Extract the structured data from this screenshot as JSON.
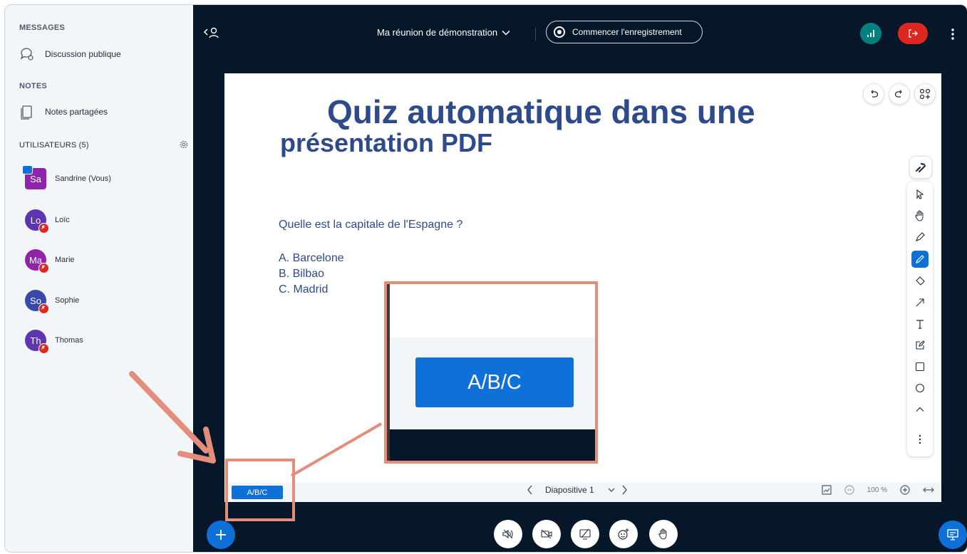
{
  "sidebar": {
    "messages_title": "MESSAGES",
    "public_chat": "Discussion publique",
    "notes_title": "NOTES",
    "shared_notes": "Notes partagées",
    "users_title": "UTILISATEURS (5)",
    "users": [
      {
        "initials": "Sa",
        "name": "Sandrine (Vous)",
        "color": "#8e24aa"
      },
      {
        "initials": "Lo",
        "name": "Loïc",
        "color": "#5e35b1"
      },
      {
        "initials": "Ma",
        "name": "Marie",
        "color": "#8e24aa"
      },
      {
        "initials": "So",
        "name": "Sophie",
        "color": "#3949ab"
      },
      {
        "initials": "Th",
        "name": "Thomas",
        "color": "#5e35b1"
      }
    ]
  },
  "header": {
    "meeting_title": "Ma réunion de démonstration",
    "record_label": "Commencer l'enregistrement"
  },
  "slide": {
    "title_line1": "Quiz automatique dans une",
    "title_line2": "présentation PDF",
    "question": "Quelle est la capitale de l'Espagne ?",
    "answers": [
      "A. Barcelone",
      "B. Bilbao",
      "C. Madrid"
    ]
  },
  "slidebar": {
    "quiz_button": "A/B/C",
    "slide_label": "Diapositive 1",
    "zoom_value": "100 %"
  },
  "callout": {
    "zoomed_button": "A/B/C"
  },
  "icons": {
    "chat": "chat-icon",
    "notes": "notes-icon",
    "settings": "gear-icon",
    "toggle": "user-list-toggle-icon",
    "record": "record-icon",
    "connection": "signal-icon",
    "leave": "leave-icon",
    "menu": "kebab-icon"
  },
  "colors": {
    "accent": "#0f70d7",
    "danger": "#df2721",
    "dark_bg": "#06172a",
    "connection": "#008081",
    "callout": "#e38d7a",
    "slide_text": "#2e4a8a"
  }
}
